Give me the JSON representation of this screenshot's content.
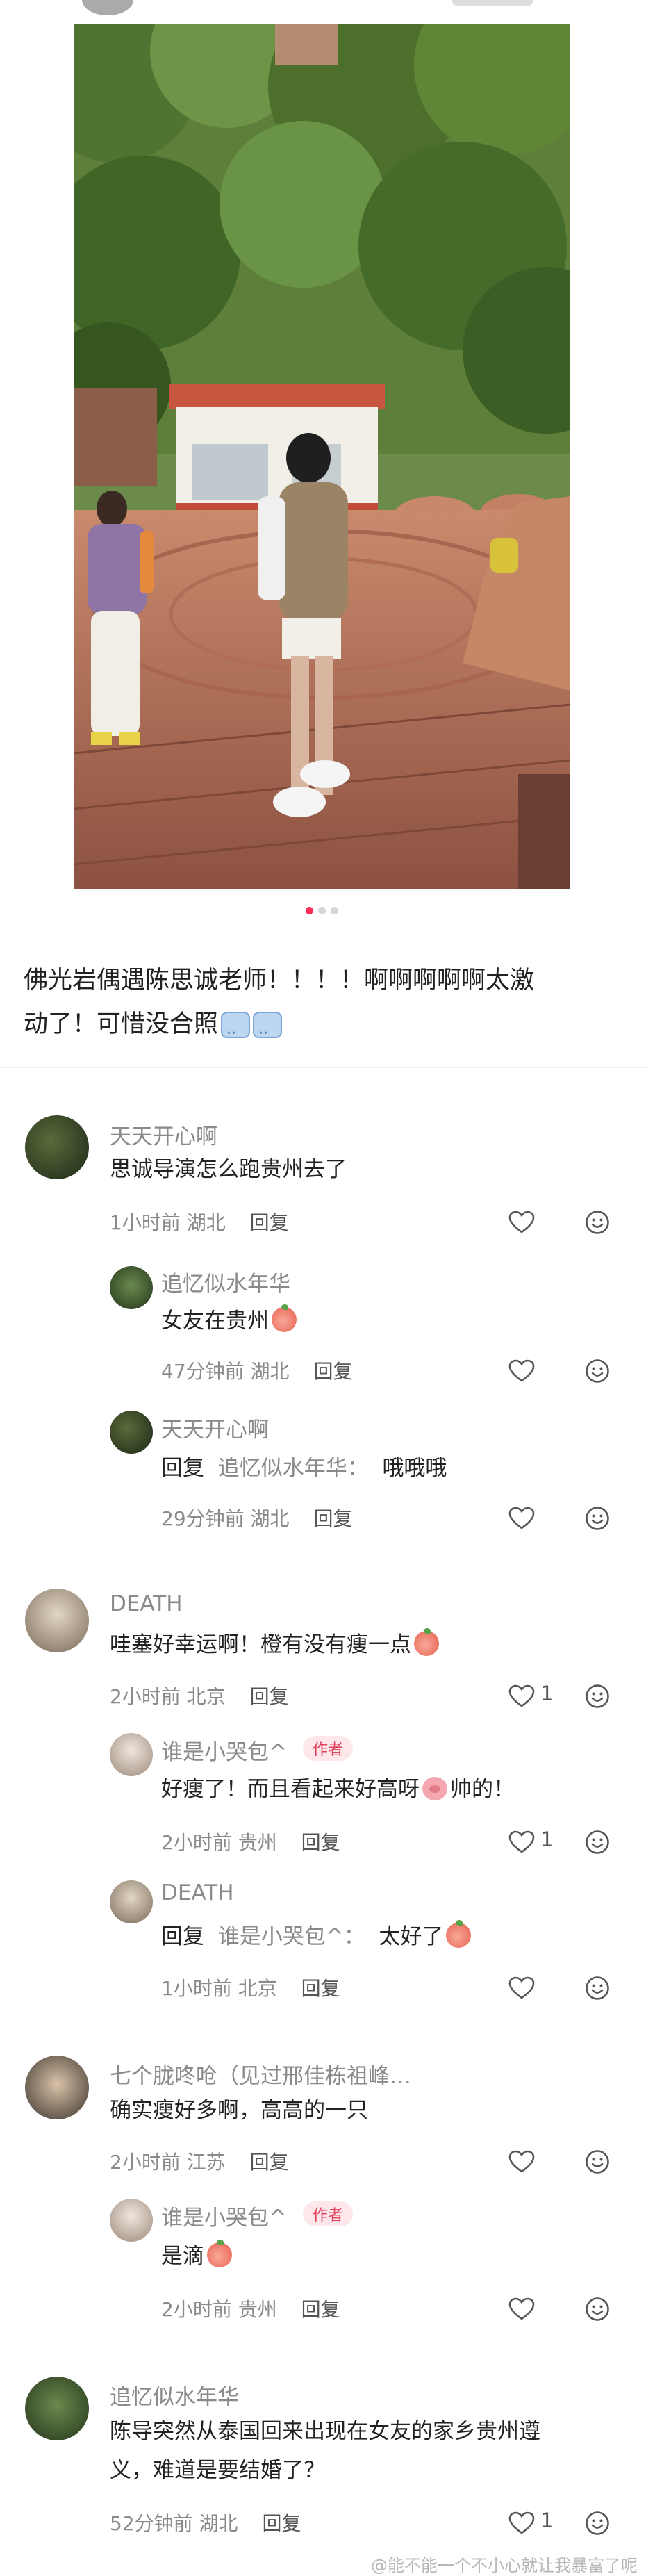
{
  "post": {
    "caption_line1": "佛光岩偶遇陈思诚老师！！！！啊啊啊啊啊太激",
    "caption_line2": "动了！可惜没合照",
    "photo_pages": 3,
    "photo_active_page": 1
  },
  "comments": [
    {
      "id": "c1",
      "name": "天天开心啊",
      "text": "思诚导演怎么跑贵州去了",
      "time": "1小时前",
      "location": "湖北",
      "reply_label": "回复",
      "likes": ""
    },
    {
      "id": "c1r1",
      "name": "追忆似水年华",
      "text": "女友在贵州",
      "time": "47分钟前",
      "location": "湖北",
      "reply_label": "回复",
      "likes": ""
    },
    {
      "id": "c1r2",
      "name": "天天开心啊",
      "reply_prefix": "回复",
      "reply_to": "追忆似水年华：",
      "text": "哦哦哦",
      "time": "29分钟前",
      "location": "湖北",
      "reply_label": "回复",
      "likes": ""
    },
    {
      "id": "c2",
      "name": "DEATH",
      "text": "哇塞好幸运啊！橙有没有瘦一点",
      "time": "2小时前",
      "location": "北京",
      "reply_label": "回复",
      "likes": "1"
    },
    {
      "id": "c2r1",
      "name": "谁是小哭包^",
      "author_tag": "作者",
      "text_a": "好瘦了！而且看起来好高呀",
      "text_b": "帅的！",
      "time": "2小时前",
      "location": "贵州",
      "reply_label": "回复",
      "likes": "1"
    },
    {
      "id": "c2r2",
      "name": "DEATH",
      "reply_prefix": "回复",
      "reply_to": "谁是小哭包^：",
      "text": "太好了",
      "time": "1小时前",
      "location": "北京",
      "reply_label": "回复",
      "likes": ""
    },
    {
      "id": "c3",
      "name": "七个胧咚呛（见过邢佳栋祖峰…",
      "text": "确实瘦好多啊，高高的一只",
      "time": "2小时前",
      "location": "江苏",
      "reply_label": "回复",
      "likes": ""
    },
    {
      "id": "c3r1",
      "name": "谁是小哭包^",
      "author_tag": "作者",
      "text": "是滴",
      "time": "2小时前",
      "location": "贵州",
      "reply_label": "回复",
      "likes": ""
    },
    {
      "id": "c4",
      "name": "追忆似水年华",
      "text_line1": "陈导突然从泰国回来出现在女友的家乡贵州遵",
      "text_line2": "义，难道是要结婚了？",
      "time": "52分钟前",
      "location": "湖北",
      "reply_label": "回复",
      "likes": "1"
    }
  ],
  "watermark": "@能不能一个不小心就让我暴富了呢",
  "colors": {
    "accent_dot": "#ff2d55",
    "tag_text": "#e0405a",
    "tag_bg": "#fde7ea"
  }
}
